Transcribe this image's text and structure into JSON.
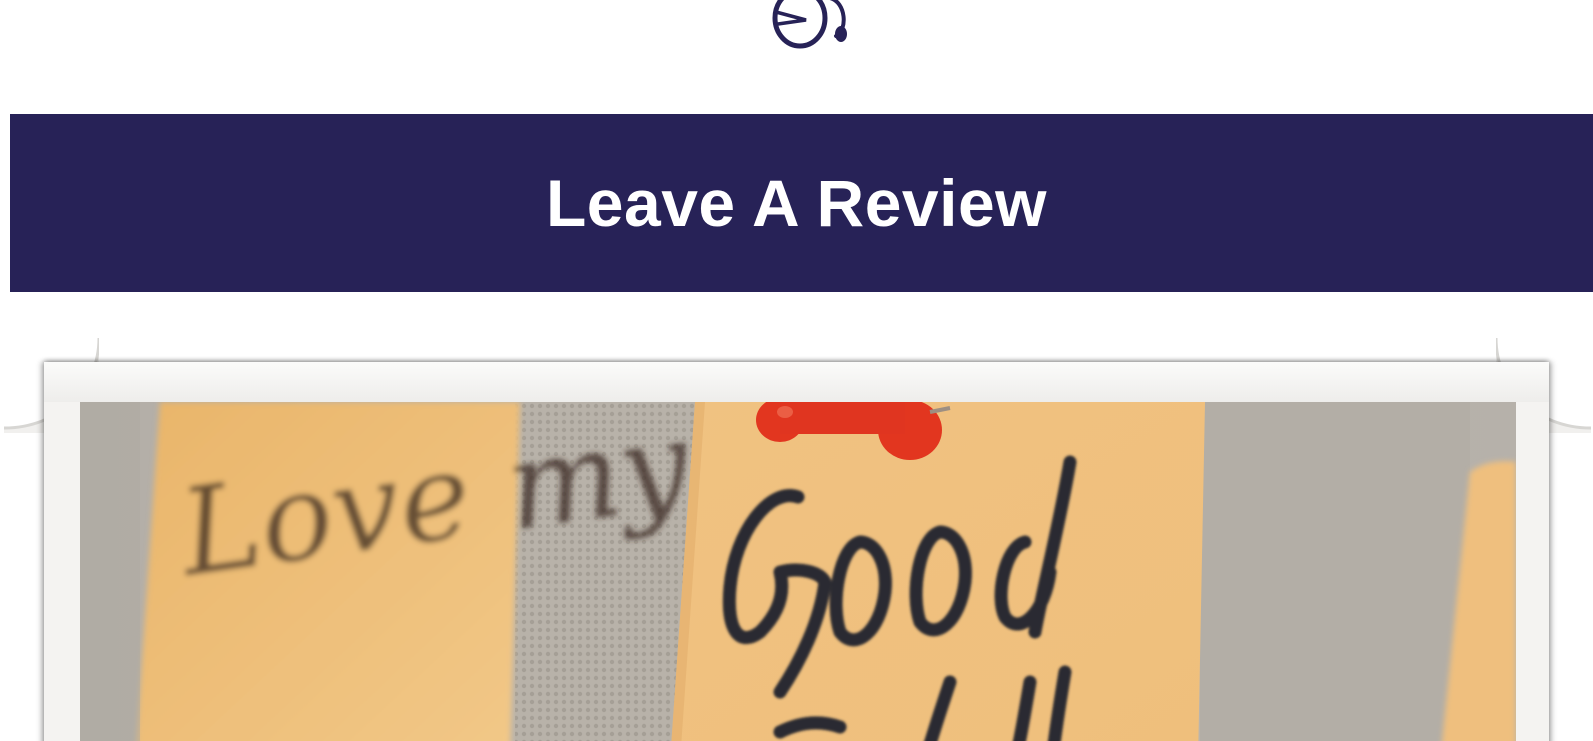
{
  "header": {
    "logo_icon": "headset-logo-icon"
  },
  "banner": {
    "title": "Leave A Review",
    "background_color": "#272257",
    "text_color": "#ffffff"
  },
  "hero_image": {
    "icon": "sticky-notes-photo",
    "note_left_text": "Love my",
    "note_center_text": "Good job"
  }
}
